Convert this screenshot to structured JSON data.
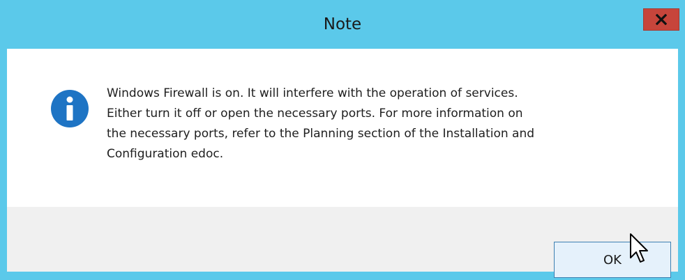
{
  "dialog": {
    "title": "Note",
    "close_icon": "close-icon",
    "info_icon": "info-icon",
    "message": "Windows Firewall is on. It will interfere with the operation of services.\nEither turn it off or open the necessary ports. For more information on\nthe necessary ports, refer to the Planning section of the Installation and\nConfiguration edoc.",
    "ok_label": "OK"
  },
  "colors": {
    "titlebar": "#5bc9ea",
    "close_button": "#c7453b",
    "info_icon": "#1e74c4",
    "footer": "#f0f0f0",
    "ok_button_bg": "#e5f1fb",
    "ok_button_border": "#3c7fb1"
  },
  "cursor_icon": "mouse-pointer-icon"
}
